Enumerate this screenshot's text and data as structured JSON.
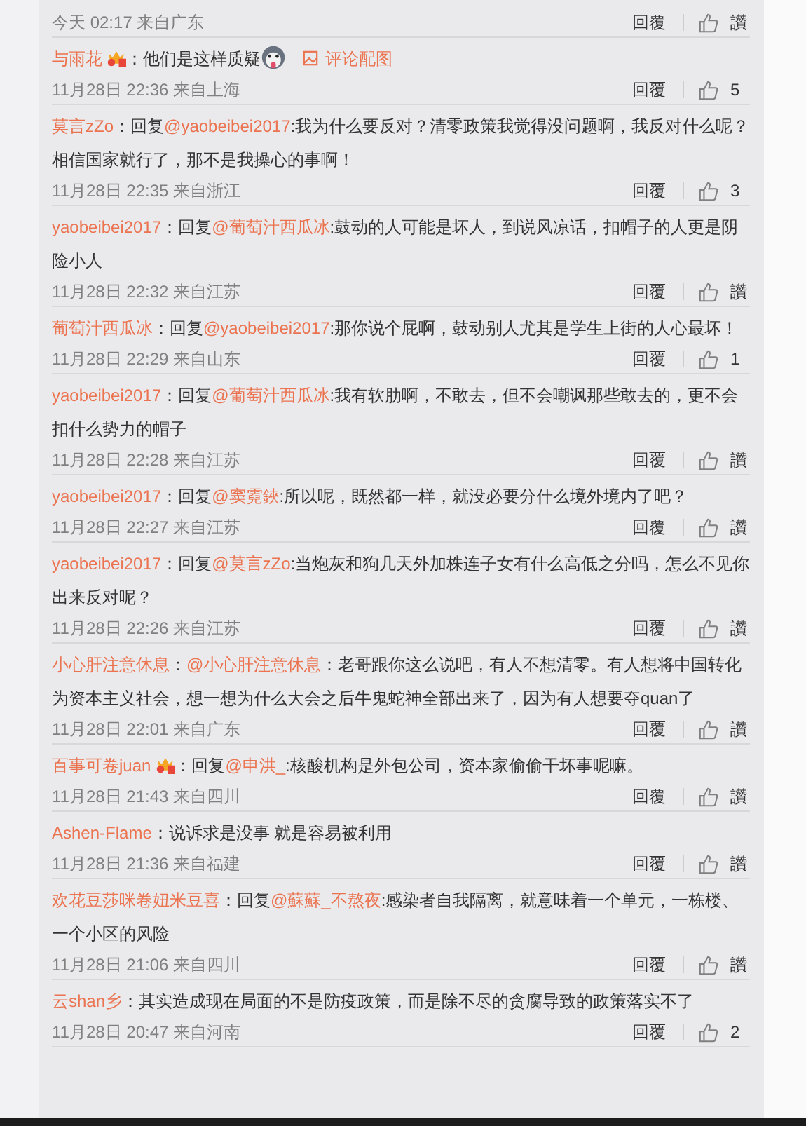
{
  "comments": [
    {
      "time": "今天 02:17 来自广东",
      "reply": "回覆",
      "likes": "讚"
    },
    {
      "parts": [
        {
          "kind": "user",
          "text": "与雨花"
        },
        {
          "kind": "badge"
        },
        {
          "kind": "plain",
          "text": "：他们是这样质疑"
        },
        {
          "kind": "emoji"
        },
        {
          "kind": "image_link",
          "text": "评论配图"
        }
      ],
      "time": "11月28日 22:36 来自上海",
      "reply": "回覆",
      "likes": "5"
    },
    {
      "parts": [
        {
          "kind": "user",
          "text": "莫言zZo"
        },
        {
          "kind": "plain",
          "text": "：回复"
        },
        {
          "kind": "mention",
          "text": "@yaobeibei2017"
        },
        {
          "kind": "plain",
          "text": ":我为什么要反对？清零政策我觉得没问题啊，我反对什么呢？相信国家就行了，那不是我操心的事啊！"
        }
      ],
      "time": "11月28日 22:35 来自浙江",
      "reply": "回覆",
      "likes": "3"
    },
    {
      "parts": [
        {
          "kind": "user",
          "text": "yaobeibei2017"
        },
        {
          "kind": "plain",
          "text": "：回复"
        },
        {
          "kind": "mention",
          "text": "@葡萄汁西瓜冰"
        },
        {
          "kind": "plain",
          "text": ":鼓动的人可能是坏人，到说风凉话，扣帽子的人更是阴险小人"
        }
      ],
      "time": "11月28日 22:32 来自江苏",
      "reply": "回覆",
      "likes": "讚"
    },
    {
      "parts": [
        {
          "kind": "user",
          "text": "葡萄汁西瓜冰"
        },
        {
          "kind": "plain",
          "text": "：回复"
        },
        {
          "kind": "mention",
          "text": "@yaobeibei2017"
        },
        {
          "kind": "plain",
          "text": ":那你说个屁啊，鼓动别人尤其是学生上街的人心最坏！"
        }
      ],
      "time": "11月28日 22:29 来自山东",
      "reply": "回覆",
      "likes": "1"
    },
    {
      "parts": [
        {
          "kind": "user",
          "text": "yaobeibei2017"
        },
        {
          "kind": "plain",
          "text": "：回复"
        },
        {
          "kind": "mention",
          "text": "@葡萄汁西瓜冰"
        },
        {
          "kind": "plain",
          "text": ":我有软肋啊，不敢去，但不会嘲讽那些敢去的，更不会扣什么势力的帽子"
        }
      ],
      "time": "11月28日 22:28 来自江苏",
      "reply": "回覆",
      "likes": "讚"
    },
    {
      "parts": [
        {
          "kind": "user",
          "text": "yaobeibei2017"
        },
        {
          "kind": "plain",
          "text": "：回复"
        },
        {
          "kind": "mention",
          "text": "@窦霓鋏"
        },
        {
          "kind": "plain",
          "text": ":所以呢，既然都一样，就没必要分什么境外境内了吧？"
        }
      ],
      "time": "11月28日 22:27 来自江苏",
      "reply": "回覆",
      "likes": "讚"
    },
    {
      "parts": [
        {
          "kind": "user",
          "text": "yaobeibei2017"
        },
        {
          "kind": "plain",
          "text": "：回复"
        },
        {
          "kind": "mention",
          "text": "@莫言zZo"
        },
        {
          "kind": "plain",
          "text": ":当炮灰和狗几天外加株连子女有什么高低之分吗，怎么不见你出来反对呢？"
        }
      ],
      "time": "11月28日 22:26 来自江苏",
      "reply": "回覆",
      "likes": "讚"
    },
    {
      "parts": [
        {
          "kind": "user",
          "text": "小心肝注意休息"
        },
        {
          "kind": "plain",
          "text": "："
        },
        {
          "kind": "mention",
          "text": "@小心肝注意休息"
        },
        {
          "kind": "plain",
          "text": "：老哥跟你这么说吧，有人不想清零。有人想将中国转化为资本主义社会，想一想为什么大会之后牛鬼蛇神全部出来了，因为有人想要夺quan了"
        }
      ],
      "time": "11月28日 22:01 来自广东",
      "reply": "回覆",
      "likes": "讚"
    },
    {
      "parts": [
        {
          "kind": "user",
          "text": "百事可卷juan"
        },
        {
          "kind": "badge"
        },
        {
          "kind": "plain",
          "text": "：回复"
        },
        {
          "kind": "mention",
          "text": "@申洪_"
        },
        {
          "kind": "plain",
          "text": ":核酸机构是外包公司，资本家偷偷干坏事呢嘛。"
        }
      ],
      "time": "11月28日 21:43 来自四川",
      "reply": "回覆",
      "likes": "讚"
    },
    {
      "parts": [
        {
          "kind": "user",
          "text": "Ashen-Flame"
        },
        {
          "kind": "plain",
          "text": "：说诉求是没事 就是容易被利用"
        }
      ],
      "time": "11月28日 21:36 来自福建",
      "reply": "回覆",
      "likes": "讚"
    },
    {
      "parts": [
        {
          "kind": "user",
          "text": "欢花豆莎咪卷妞米豆喜"
        },
        {
          "kind": "plain",
          "text": "：回复"
        },
        {
          "kind": "mention",
          "text": "@蘇蘇_不熬夜"
        },
        {
          "kind": "plain",
          "text": ":感染者自我隔离，就意味着一个单元，一栋楼、一个小区的风险"
        }
      ],
      "time": "11月28日 21:06 来自四川",
      "reply": "回覆",
      "likes": "讚"
    },
    {
      "parts": [
        {
          "kind": "user",
          "text": "云shan乡"
        },
        {
          "kind": "plain",
          "text": "：其实造成现在局面的不是防疫政策，而是除不尽的贪腐导致的政策落实不了"
        }
      ],
      "time": "11月28日 20:47 来自河南",
      "reply": "回覆",
      "likes": "2"
    }
  ]
}
